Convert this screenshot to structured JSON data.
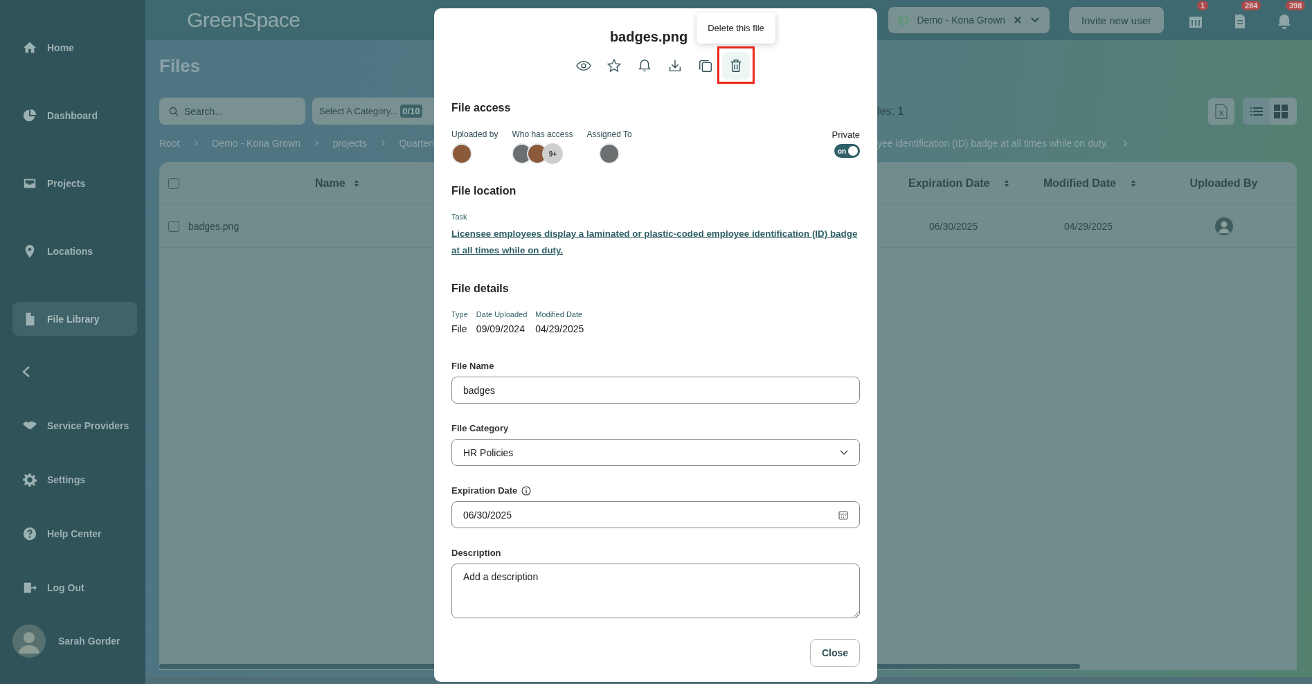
{
  "sidebar": {
    "items": [
      {
        "label": "Home",
        "selected": false
      },
      {
        "label": "Dashboard",
        "selected": false
      },
      {
        "label": "Projects",
        "selected": false
      },
      {
        "label": "Locations",
        "selected": false
      },
      {
        "label": "File Library",
        "selected": true
      },
      {
        "label": "Service Providers",
        "selected": false
      },
      {
        "label": "Settings",
        "selected": false
      },
      {
        "label": "Help Center",
        "selected": false
      },
      {
        "label": "Log Out",
        "selected": false
      }
    ],
    "user": {
      "name": "Sarah Gorder"
    }
  },
  "topbar": {
    "logo": "GreenSpace",
    "organization": "Demo - Kona Grown",
    "invite_button": "Invite new user",
    "notifications": [
      {
        "kind": "calendar",
        "count": "1"
      },
      {
        "kind": "document",
        "count": "284"
      },
      {
        "kind": "bell",
        "count": "398"
      }
    ]
  },
  "page": {
    "title": "Files",
    "search": {
      "placeholder": "Search..."
    },
    "category_filter": {
      "label": "Select A Category...",
      "count": "0/10"
    },
    "total_files_fragment": "les: ",
    "total_files_count": "1",
    "breadcrumbs": [
      "Root",
      "Demo - Kona Grown",
      "projects",
      "Quarterl"
    ],
    "breadcrumb_tail": "yee identification (ID) badge at all times while on duty.",
    "view_modes": [
      {
        "kind": "list",
        "selected": false
      },
      {
        "kind": "grid",
        "selected": true
      }
    ],
    "table": {
      "select_all_checked": false,
      "columns": [
        "Name",
        "Expiration Date",
        "Modified Date",
        "Uploaded By"
      ],
      "rows": [
        {
          "name": "badges.png",
          "checked": false,
          "expiration_date": "06/30/2025",
          "modified_date": "04/29/2025"
        }
      ]
    }
  },
  "modal": {
    "title": "badges.png",
    "actions": [
      {
        "kind": "view",
        "hovered": false
      },
      {
        "kind": "star",
        "hovered": false
      },
      {
        "kind": "bell",
        "hovered": false
      },
      {
        "kind": "download",
        "hovered": false
      },
      {
        "kind": "copy",
        "hovered": false
      },
      {
        "kind": "delete",
        "hovered": true,
        "tooltip": "Delete this file"
      }
    ],
    "file_access": {
      "heading": "File access",
      "uploaded_by_label": "Uploaded by",
      "who_has_access_label": "Who has access",
      "access_more": "9+",
      "assigned_to_label": "Assigned To",
      "private_label": "Private",
      "private_on": true,
      "private_toggle_text": "on"
    },
    "file_location": {
      "heading": "File location",
      "label": "Task",
      "link": "Licensee employees display a laminated or plastic-coded employee identification (ID) badge at all times while on duty."
    },
    "file_details": {
      "heading": "File details",
      "fields": [
        {
          "label": "Type",
          "value": "File"
        },
        {
          "label": "Date Uploaded",
          "value": "09/09/2024"
        },
        {
          "label": "Modified Date",
          "value": "04/29/2025"
        }
      ]
    },
    "file_name": {
      "label": "File Name",
      "value": "badges"
    },
    "file_category": {
      "label": "File Category",
      "value": "HR Policies"
    },
    "expiration_date": {
      "label": "Expiration Date",
      "value": "06/30/2025"
    },
    "description": {
      "label": "Description",
      "placeholder": "Add a description"
    },
    "close_button": "Close"
  }
}
